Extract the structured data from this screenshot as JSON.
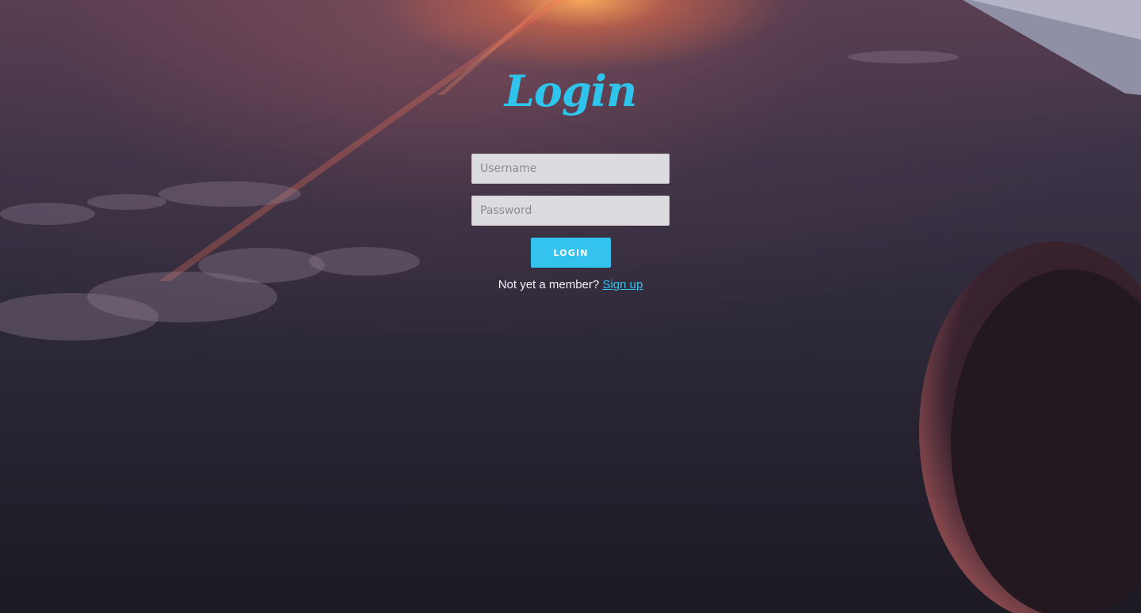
{
  "page": {
    "background_description_icon": "airplane-window-sunset-background"
  },
  "login": {
    "title": "Login",
    "username_placeholder": "Username",
    "password_placeholder": "Password",
    "submit_label": "LOGIN",
    "signup_prompt": "Not yet a member?",
    "signup_link": "Sign up"
  },
  "colors": {
    "accent": "#34c3ee",
    "title": "#2ec4ec",
    "input_bg": "#dcdce0",
    "text_light": "#f2f2f4"
  }
}
